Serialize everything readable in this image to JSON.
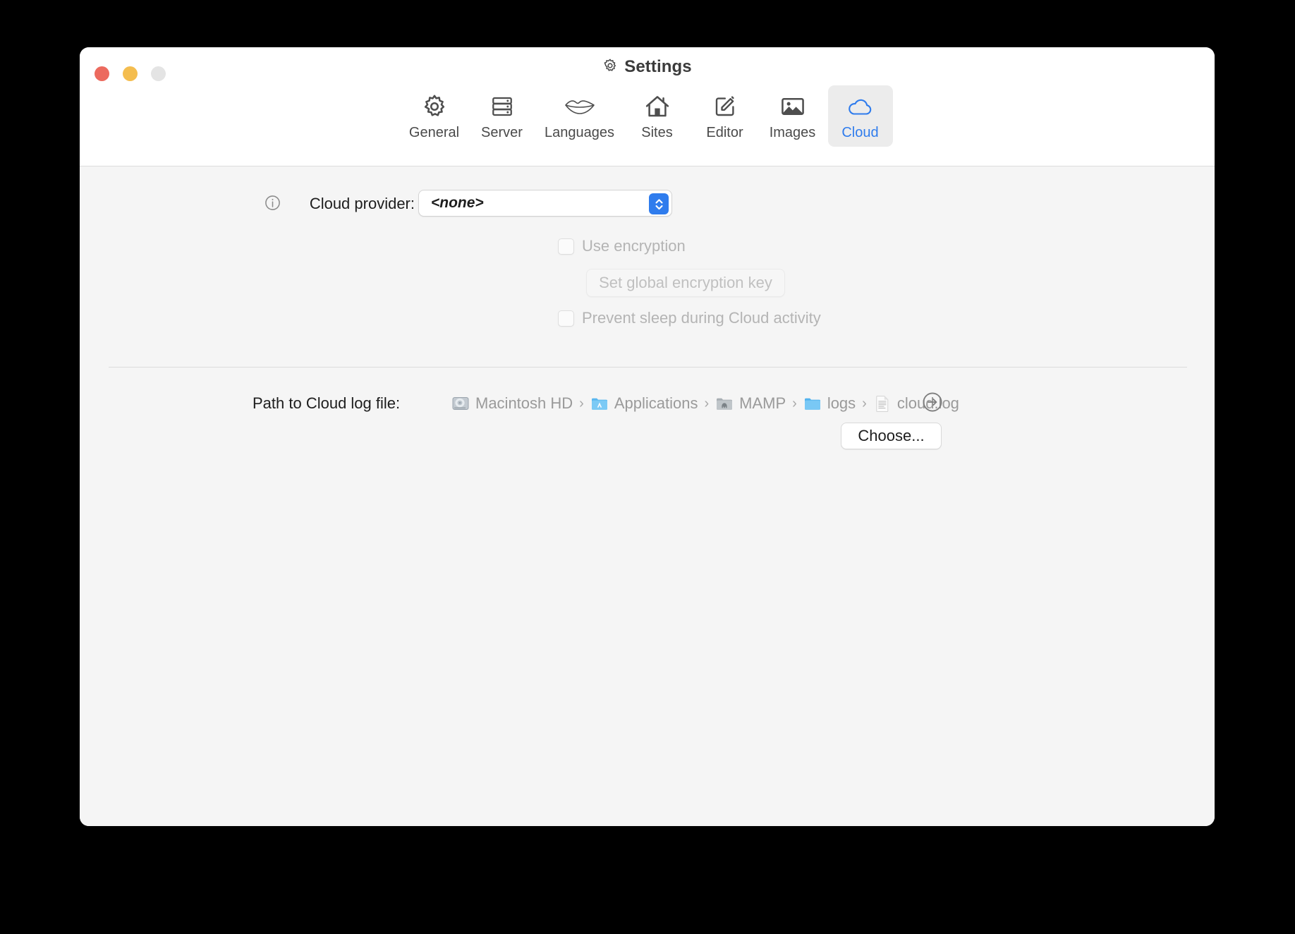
{
  "window": {
    "title": "Settings",
    "title_icon": "gear-icon",
    "traffic_lights": [
      {
        "name": "close-button",
        "color": "#ec6a5e"
      },
      {
        "name": "minimize-button",
        "color": "#f4bd4f"
      },
      {
        "name": "zoom-button",
        "color": "#e4e4e4"
      }
    ]
  },
  "toolbar": {
    "selected_tab": "Cloud",
    "accent_color": "#2f7ced",
    "tabs": [
      {
        "label": "General",
        "icon": "gear-icon"
      },
      {
        "label": "Server",
        "icon": "server-rack-icon"
      },
      {
        "label": "Languages",
        "icon": "lips-icon"
      },
      {
        "label": "Sites",
        "icon": "house-icon"
      },
      {
        "label": "Editor",
        "icon": "pencil-square-icon"
      },
      {
        "label": "Images",
        "icon": "picture-icon"
      },
      {
        "label": "Cloud",
        "icon": "cloud-icon"
      }
    ]
  },
  "cloud_settings": {
    "provider": {
      "info_icon": "info-circle-icon",
      "label": "Cloud provider:",
      "value": "<none>",
      "options": [
        "<none>"
      ],
      "stepper_icon": "chevron-up-down-icon"
    },
    "use_encryption": {
      "label": "Use encryption",
      "checked": false,
      "enabled": false
    },
    "set_global_encryption_key": {
      "label": "Set global encryption key",
      "enabled": false
    },
    "prevent_sleep": {
      "label": "Prevent sleep during Cloud activity",
      "checked": false,
      "enabled": false
    }
  },
  "log_path": {
    "label": "Path to Cloud log file:",
    "separator": "›",
    "reveal_icon": "arrow-right-circle-icon",
    "crumbs": [
      {
        "text": "Macintosh HD",
        "icon": "hard-drive-icon"
      },
      {
        "text": "Applications",
        "icon": "applications-folder-icon"
      },
      {
        "text": "MAMP",
        "icon": "mamp-folder-icon"
      },
      {
        "text": "logs",
        "icon": "folder-icon"
      },
      {
        "text": "cloud.log",
        "icon": "document-icon"
      }
    ],
    "choose_button": "Choose..."
  }
}
